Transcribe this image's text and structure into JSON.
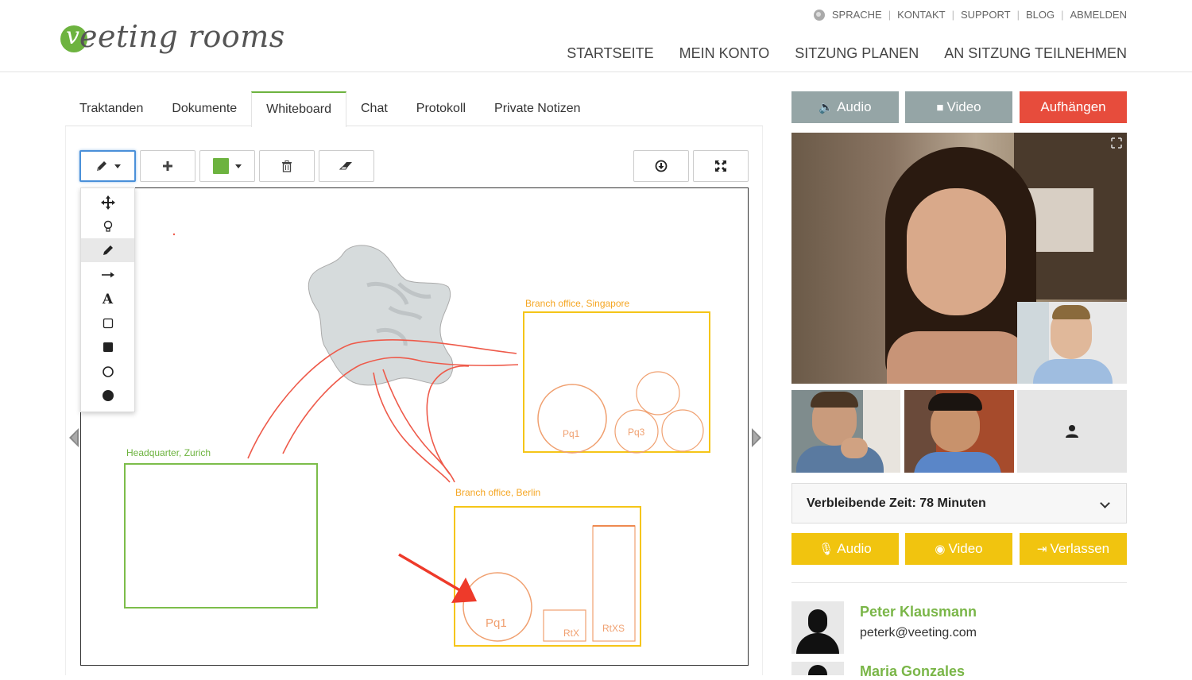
{
  "brand": {
    "logo_text": "eeting rooms",
    "logo_mark": "v",
    "accent": "#6db33f"
  },
  "util_nav": [
    "SPRACHE",
    "KONTAKT",
    "SUPPORT",
    "BLOG",
    "ABMELDEN"
  ],
  "main_nav": [
    "STARTSEITE",
    "MEIN KONTO",
    "SITZUNG PLANEN",
    "AN SITZUNG TEILNEHMEN"
  ],
  "tabs": [
    "Traktanden",
    "Dokumente",
    "Whiteboard",
    "Chat",
    "Protokoll",
    "Private Notizen"
  ],
  "active_tab": "Whiteboard",
  "toolbar": {
    "tools": [
      "pencil-icon",
      "plus-icon",
      "color-picker",
      "trash-icon",
      "eraser-icon",
      "download-icon",
      "fullscreen-icon"
    ],
    "color": "#6db33f"
  },
  "tool_menu": [
    "move-icon",
    "lightbulb-icon",
    "pencil-icon",
    "arrow-icon",
    "text-icon",
    "rectangle-outline-icon",
    "rectangle-filled-icon",
    "circle-outline-icon",
    "circle-filled-icon"
  ],
  "tool_menu_selected": "pencil-icon",
  "whiteboard": {
    "labels": {
      "singapore": "Branch office, Singapore",
      "zurich": "Headquarter, Zurich",
      "berlin": "Branch office, Berlin"
    },
    "circles": {
      "pq1_sg": "Pq1",
      "pq3": "Pq3",
      "pq1_berlin": "Pq1"
    },
    "boxes": {
      "rtx": "RtX",
      "rtxs": "RtXS"
    },
    "colors": {
      "orange": "#f5a623",
      "green": "#6db33f",
      "red": "#ee5a4a",
      "shape": "#f0a070"
    }
  },
  "call_controls": {
    "audio": "Audio",
    "video": "Video",
    "hangup": "Aufhängen",
    "audio_color": "#95a5a6",
    "hangup_color": "#e74c3c"
  },
  "timer": "Verbleibende Zeit: 78 Minuten",
  "self_controls": {
    "audio": "Audio",
    "video": "Video",
    "leave": "Verlassen",
    "color": "#f1c40f"
  },
  "participants": [
    {
      "name": "Peter Klausmann",
      "email": "peterk@veeting.com"
    },
    {
      "name": "Maria Gonzales"
    }
  ]
}
